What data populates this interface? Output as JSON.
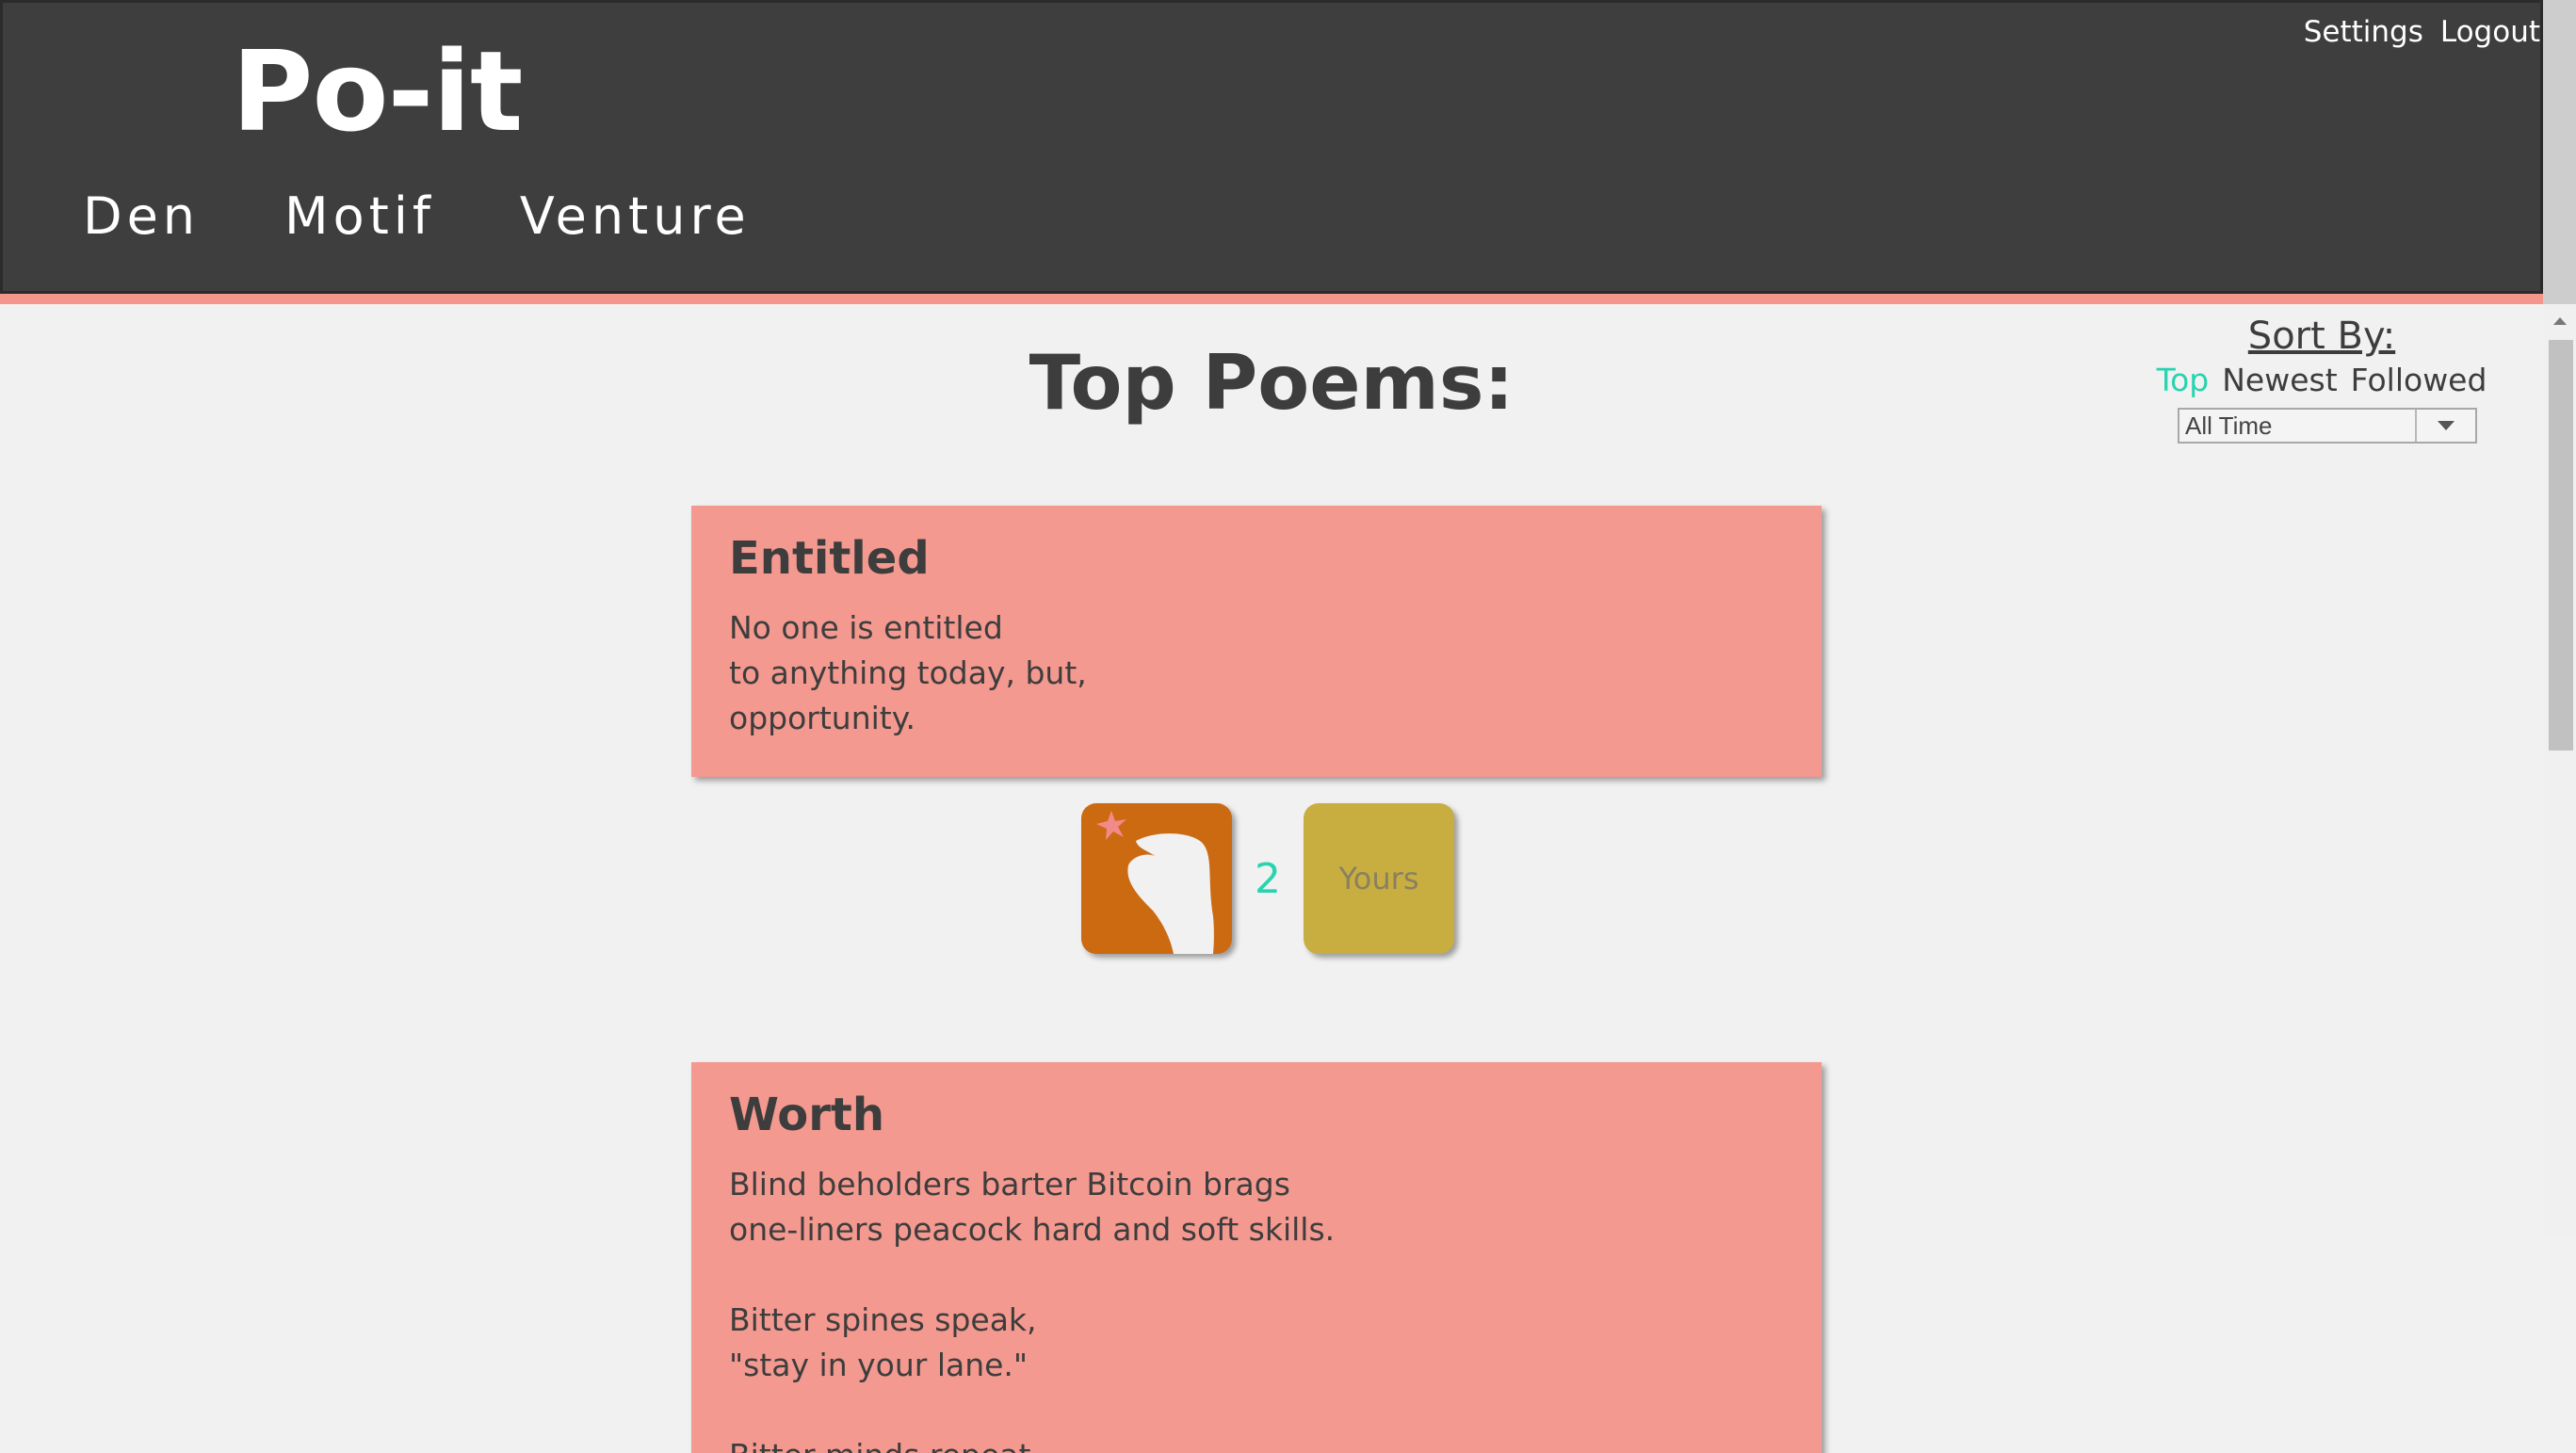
{
  "header": {
    "logo": "Po-it",
    "top_links": [
      "Settings",
      "Logout"
    ],
    "nav": [
      "Den",
      "Motif",
      "Venture"
    ]
  },
  "main": {
    "title": "Top Poems:"
  },
  "sort": {
    "label": "Sort By:",
    "options": [
      "Top",
      "Newest",
      "Followed"
    ],
    "active": "Top",
    "range": "All Time"
  },
  "poems": [
    {
      "title": "Entitled",
      "lines": [
        "No one is entitled",
        "to anything today, but,",
        "opportunity."
      ],
      "snap_count": "2",
      "yours_label": "Yours"
    },
    {
      "title": "Worth",
      "lines": [
        "Blind beholders barter Bitcoin brags",
        "one-liners peacock hard and soft skills.",
        "",
        "Bitter spines speak,",
        "\"stay in your lane.\"",
        "",
        "Bitter minds repeat"
      ]
    }
  ],
  "colors": {
    "header_bg": "#3e3e3e",
    "accent": "#f4968c",
    "card_bg": "#f4998f",
    "active_sort": "#28d3b0",
    "snap_button": "#cc6a12",
    "yours_button": "#c8ae40"
  },
  "icons": {
    "snap": "snapping-hand-icon",
    "dropdown": "chevron-down-icon"
  }
}
